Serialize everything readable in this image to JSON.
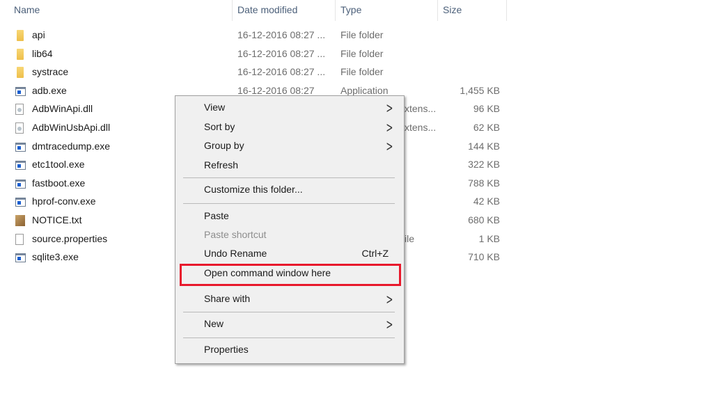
{
  "columns": {
    "name": "Name",
    "date": "Date modified",
    "type": "Type",
    "size": "Size"
  },
  "files": [
    {
      "name": "api",
      "icon": "folder",
      "date": "16-12-2016 08:27 ...",
      "type": "File folder",
      "size": ""
    },
    {
      "name": "lib64",
      "icon": "folder",
      "date": "16-12-2016 08:27 ...",
      "type": "File folder",
      "size": ""
    },
    {
      "name": "systrace",
      "icon": "folder",
      "date": "16-12-2016 08:27 ...",
      "type": "File folder",
      "size": ""
    },
    {
      "name": "adb.exe",
      "icon": "exe",
      "date": "16-12-2016 08:27",
      "type": "Application",
      "size": "1,455 KB"
    },
    {
      "name": "AdbWinApi.dll",
      "icon": "dll",
      "date": "",
      "type": "",
      "type_fragment": "xtens...",
      "size": "96 KB"
    },
    {
      "name": "AdbWinUsbApi.dll",
      "icon": "dll",
      "date": "",
      "type": "",
      "type_fragment": "xtens...",
      "size": "62 KB"
    },
    {
      "name": "dmtracedump.exe",
      "icon": "exe",
      "date": "",
      "type": "",
      "size": "144 KB"
    },
    {
      "name": "etc1tool.exe",
      "icon": "exe",
      "date": "",
      "type": "",
      "size": "322 KB"
    },
    {
      "name": "fastboot.exe",
      "icon": "exe",
      "date": "",
      "type": "",
      "size": "788 KB"
    },
    {
      "name": "hprof-conv.exe",
      "icon": "exe",
      "date": "",
      "type": "",
      "size": "42 KB"
    },
    {
      "name": "NOTICE.txt",
      "icon": "txt",
      "date": "",
      "type": "",
      "size": "680 KB"
    },
    {
      "name": "source.properties",
      "icon": "file",
      "date": "",
      "type": "",
      "type_fragment": "ile",
      "size": "1 KB"
    },
    {
      "name": "sqlite3.exe",
      "icon": "exe",
      "date": "",
      "type": "",
      "size": "710 KB"
    }
  ],
  "context_menu": {
    "view": "View",
    "sort_by": "Sort by",
    "group_by": "Group by",
    "refresh": "Refresh",
    "customize": "Customize this folder...",
    "paste": "Paste",
    "paste_shortcut": "Paste shortcut",
    "undo_rename": "Undo Rename",
    "undo_shortcut": "Ctrl+Z",
    "open_command": "Open command window here",
    "share_with": "Share with",
    "new": "New",
    "properties": "Properties",
    "highlight_color": "#e8192c"
  }
}
